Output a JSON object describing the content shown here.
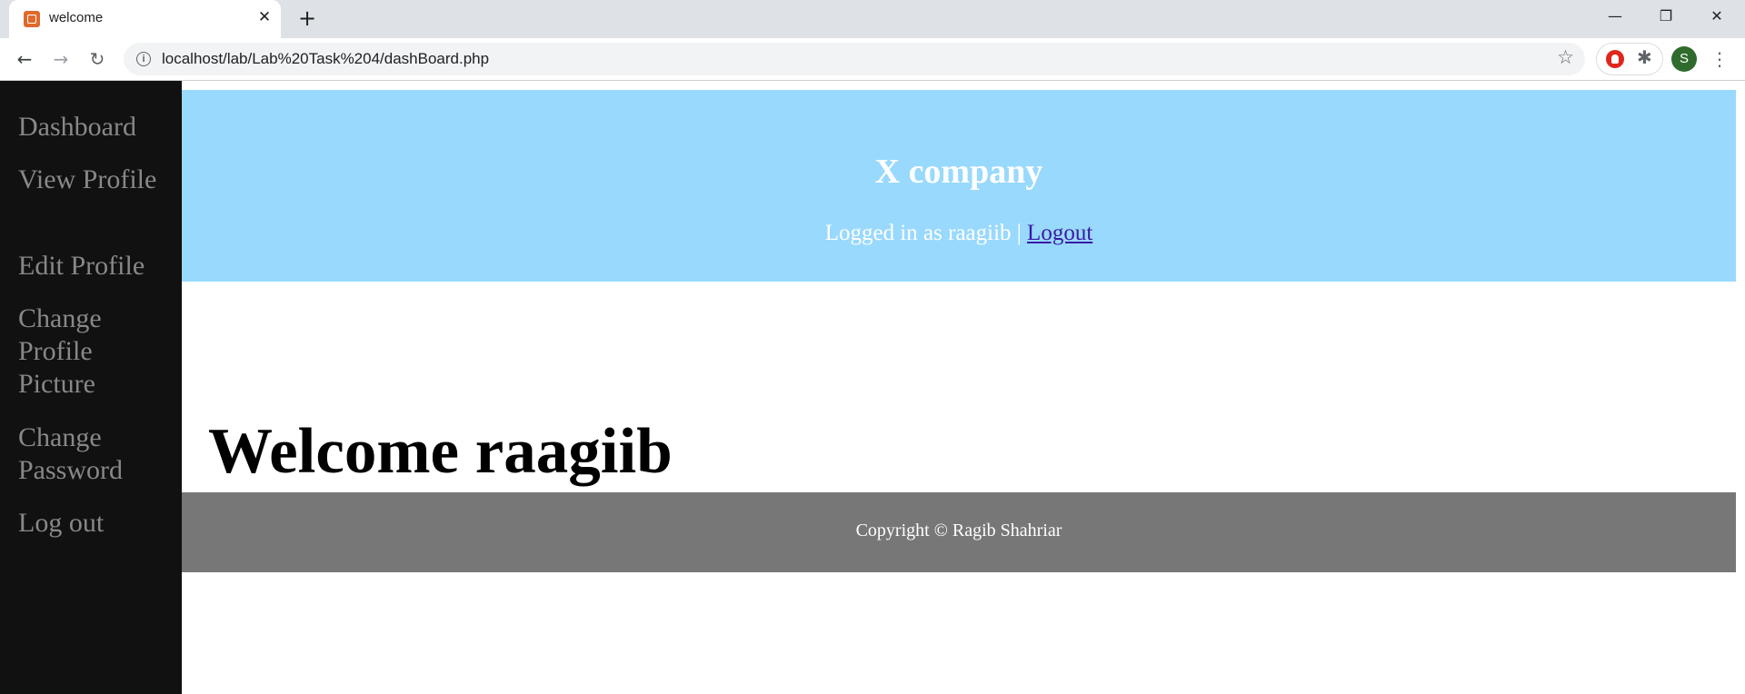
{
  "browser": {
    "tab_title": "welcome",
    "url": "localhost/lab/Lab%20Task%204/dashBoard.php",
    "profile_initial": "S"
  },
  "sidebar": {
    "items": [
      {
        "label": "Dashboard"
      },
      {
        "label": "View Profile"
      },
      {
        "label": "Edit Profile"
      },
      {
        "label": "Change Profile Picture"
      },
      {
        "label": "Change Password"
      },
      {
        "label": "Log out"
      }
    ]
  },
  "header": {
    "company": "X company",
    "logged_in_text": "Logged in as raagiib |",
    "logout_link": "Logout"
  },
  "main": {
    "welcome": "Welcome raagiib"
  },
  "footer": {
    "copyright": "Copyright © Ragib Shahriar"
  },
  "colors": {
    "header_bg": "#99d9fd",
    "sidebar_bg": "#111111",
    "footer_bg": "#777777"
  }
}
